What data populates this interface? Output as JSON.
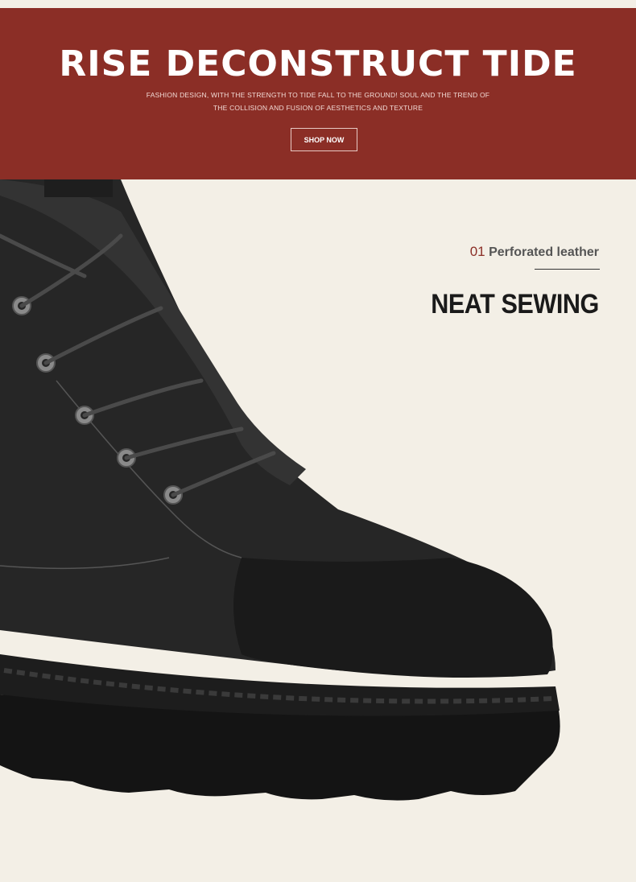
{
  "banner": {
    "title": "RISE DECONSTRUCT TIDE",
    "subtitle_line1": "FASHION DESIGN, WITH THE STRENGTH TO TIDE FALL TO THE GROUND! SOUL AND THE TREND OF",
    "subtitle_line2": "THE COLLISION AND FUSION OF AESTHETICS AND TEXTURE",
    "button_label": "SHOP NOW"
  },
  "feature": {
    "number": "01",
    "label": "Perforated leather",
    "title": "NEAT SEWING"
  },
  "colors": {
    "banner_bg": "#8b2e26",
    "page_bg": "#f3efe6",
    "accent": "#8b2e26"
  }
}
